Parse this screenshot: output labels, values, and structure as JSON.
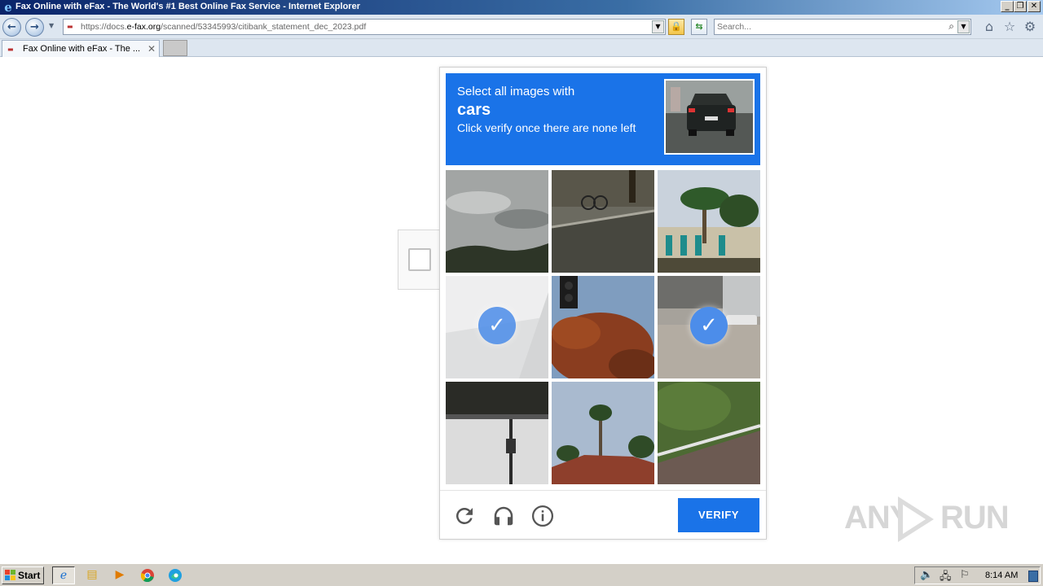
{
  "window": {
    "title": "Fax Online with eFax - The World's #1 Best Online Fax Service - Internet Explorer",
    "controls": {
      "minimize": "_",
      "restore": "❐",
      "close": "✕"
    }
  },
  "address_bar": {
    "url_prefix": "https://docs.",
    "url_domain": "e-fax.org",
    "url_path": "/scanned/53345993/citibank_statement_dec_2023.pdf"
  },
  "search": {
    "placeholder": "Search..."
  },
  "tabs": [
    {
      "label": "Fax Online with eFax - The ...",
      "close": "✕"
    }
  ],
  "captcha": {
    "prompt_line1": "Select all images with",
    "prompt_target": "cars",
    "prompt_line3": "Click verify once there are none left",
    "tiles": [
      {
        "name": "cloudy-sky-treeline",
        "selected": false
      },
      {
        "name": "sidewalk-bike-rack",
        "selected": false
      },
      {
        "name": "palm-tree-building",
        "selected": false
      },
      {
        "name": "faded-highway",
        "selected": true
      },
      {
        "name": "traffic-light-tree",
        "selected": false
      },
      {
        "name": "parking-lot-cars",
        "selected": true
      },
      {
        "name": "overpass-underside",
        "selected": false
      },
      {
        "name": "palm-trees-rooftop",
        "selected": false
      },
      {
        "name": "guardrail-road",
        "selected": false
      }
    ],
    "verify_label": "VERIFY",
    "accent_color": "#1a73e8"
  },
  "watermark": {
    "text_left": "ANY",
    "text_right": "RUN"
  },
  "taskbar": {
    "start_label": "Start",
    "clock": "8:14 AM"
  }
}
